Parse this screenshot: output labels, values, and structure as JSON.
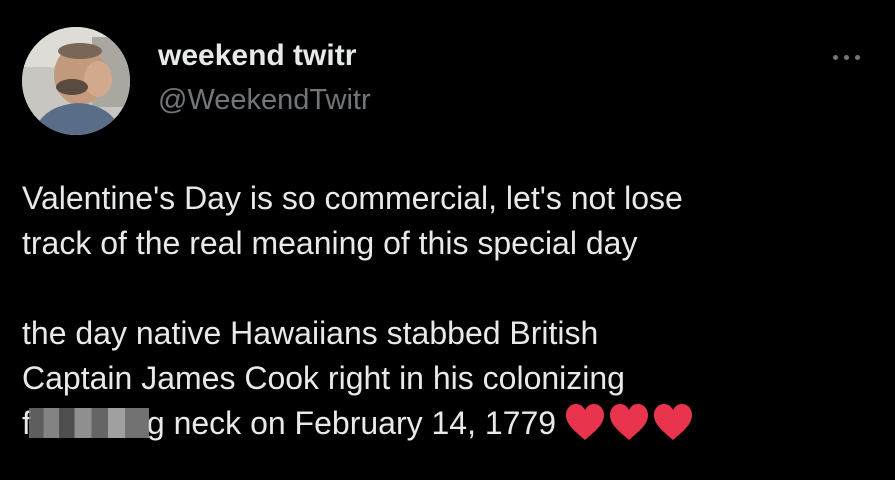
{
  "author": {
    "display_name": "weekend twitr",
    "handle": "@WeekendTwitr",
    "avatar_icon": "profile-photo"
  },
  "more_icon": "more-horizontal-icon",
  "tweet": {
    "line1": "Valentine's Day is so commercial, let's not lose",
    "line2": "track of the real meaning of this special day",
    "line3": "the day native Hawaiians stabbed British",
    "line4": "Captain James Cook right in his colonizing",
    "line5_prefix": "f",
    "line5_suffix": "g neck on February 14, 1779",
    "emoji": [
      "red-heart-icon",
      "red-heart-icon",
      "red-heart-icon"
    ]
  },
  "colors": {
    "background": "#000000",
    "text_primary": "#e7e9ea",
    "text_secondary": "#71767b",
    "heart": "#e8344c"
  }
}
